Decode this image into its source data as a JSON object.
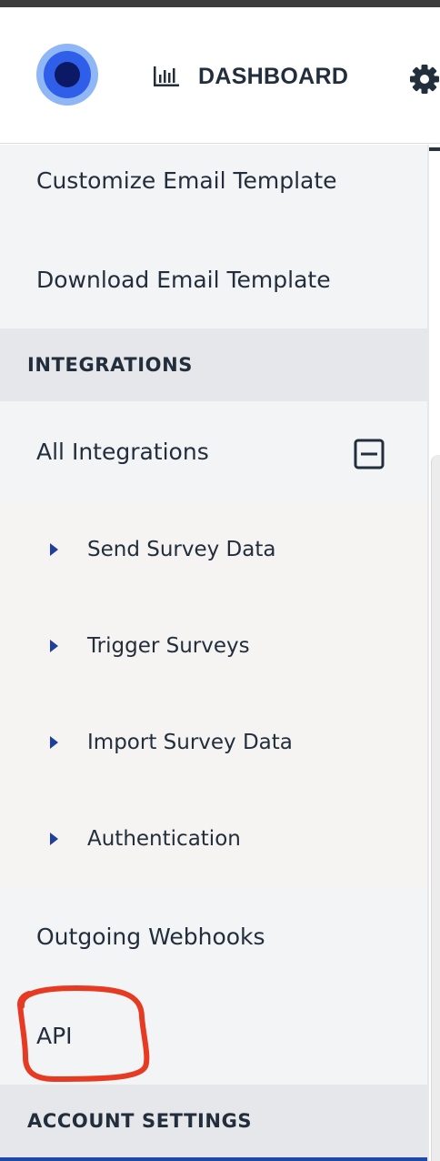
{
  "header": {
    "dashboard_label": "DASHBOARD",
    "logo_icon": "logo-icon",
    "dashboard_icon": "bar-chart-icon",
    "settings_icon": "gear-icon"
  },
  "sidebar": {
    "items": [
      {
        "label": "Customize Email Template"
      },
      {
        "label": "Download Email Template"
      }
    ],
    "integrations_section": "INTEGRATIONS",
    "all_integrations": "All Integrations",
    "sub_items": [
      {
        "label": "Send Survey Data"
      },
      {
        "label": "Trigger Surveys"
      },
      {
        "label": "Import Survey Data"
      },
      {
        "label": "Authentication"
      }
    ],
    "outgoing_webhooks": "Outgoing Webhooks",
    "api": "API",
    "account_section": "ACCOUNT SETTINGS"
  },
  "colors": {
    "accent": "#1f3f9c",
    "annotation": "#e63a22",
    "logo_outer": "#8fb6f5",
    "logo_mid": "#2f5fe8",
    "logo_core": "#0c1a66"
  }
}
